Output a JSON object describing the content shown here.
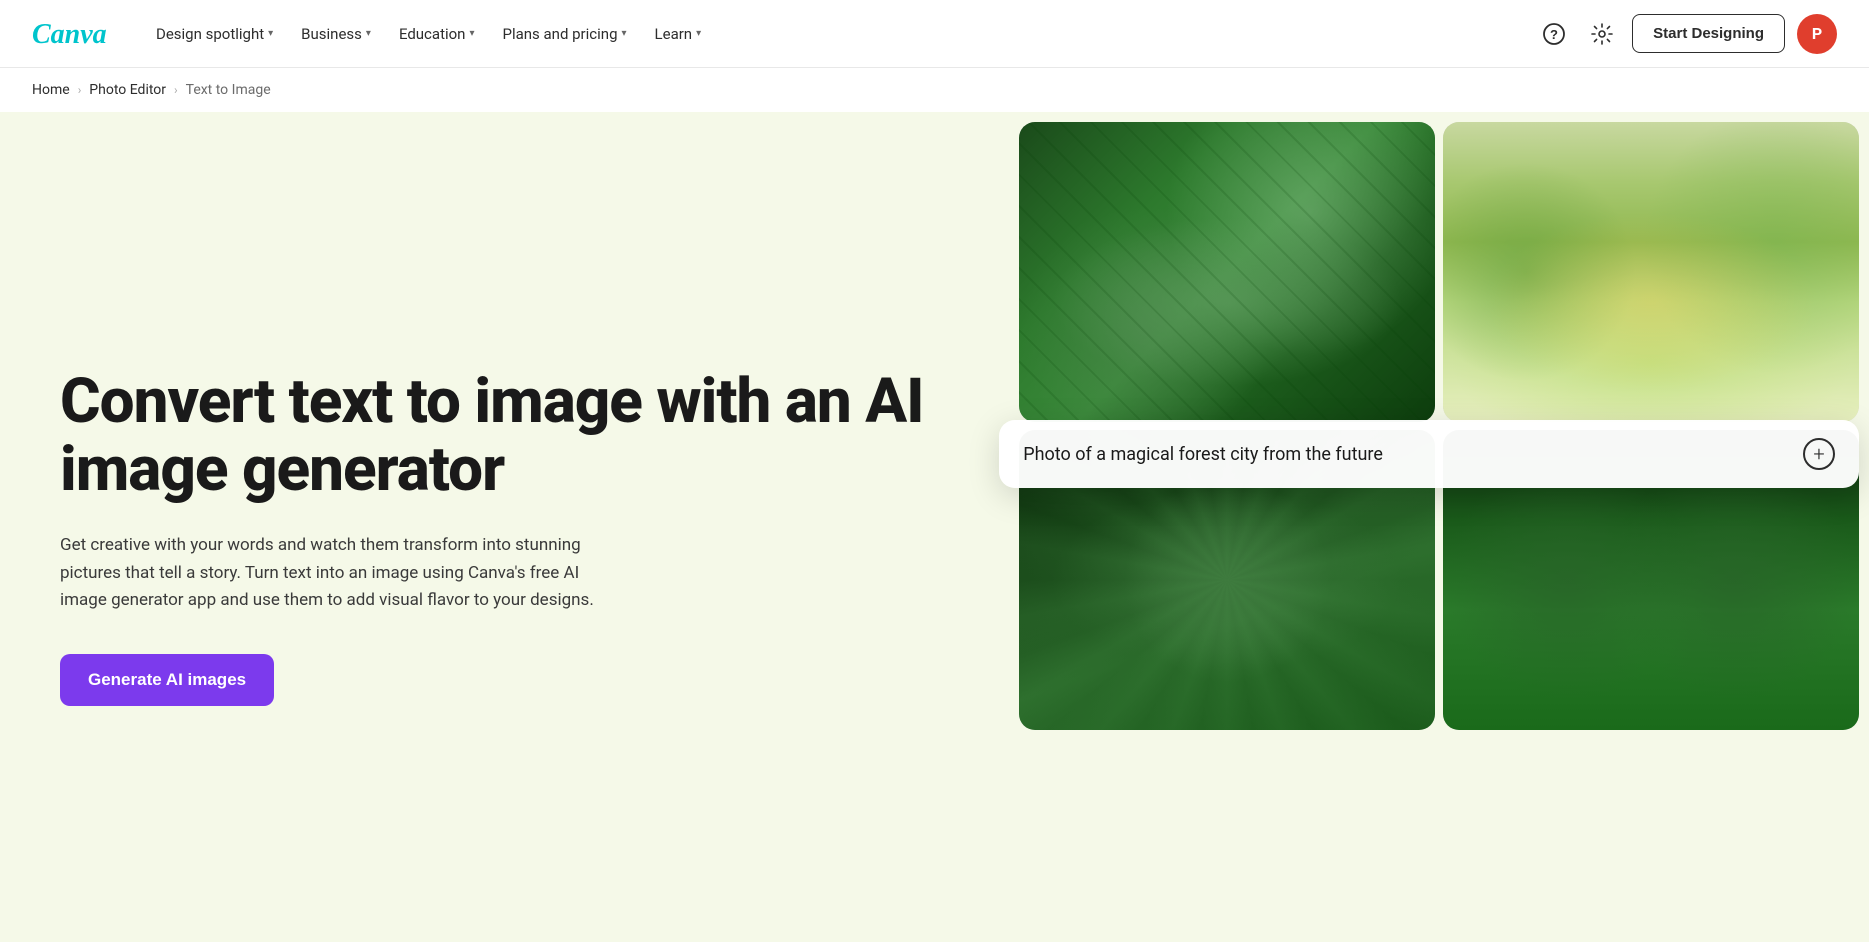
{
  "navbar": {
    "logo_text": "Canva",
    "links": [
      {
        "id": "design-spotlight",
        "label": "Design spotlight",
        "has_dropdown": true
      },
      {
        "id": "business",
        "label": "Business",
        "has_dropdown": true
      },
      {
        "id": "education",
        "label": "Education",
        "has_dropdown": true
      },
      {
        "id": "plans-pricing",
        "label": "Plans and pricing",
        "has_dropdown": true
      },
      {
        "id": "learn",
        "label": "Learn",
        "has_dropdown": true
      }
    ],
    "start_designing_label": "Start Designing",
    "user_initials": "P"
  },
  "breadcrumb": {
    "items": [
      {
        "label": "Home",
        "id": "home"
      },
      {
        "label": "Photo Editor",
        "id": "photo-editor"
      },
      {
        "label": "Text to Image",
        "id": "text-to-image",
        "current": true
      }
    ]
  },
  "hero": {
    "title": "Convert text to image with an AI image generator",
    "subtitle": "Get creative with your words and watch them transform into stunning pictures that tell a story. Turn text into an image using Canva's free AI image generator app and use them to add visual flavor to your designs.",
    "cta_label": "Generate AI images"
  },
  "prompt_card": {
    "text": "Photo of a magical forest city from the future",
    "plus_icon": "+"
  },
  "images": [
    {
      "id": "img-1",
      "alt": "Aerial view of green futuristic city"
    },
    {
      "id": "img-2",
      "alt": "Misty magical forest with golden light"
    },
    {
      "id": "img-3",
      "alt": "Aerial view of winding roads through forest"
    },
    {
      "id": "img-4",
      "alt": "Ancient tall trees in green forest"
    }
  ]
}
